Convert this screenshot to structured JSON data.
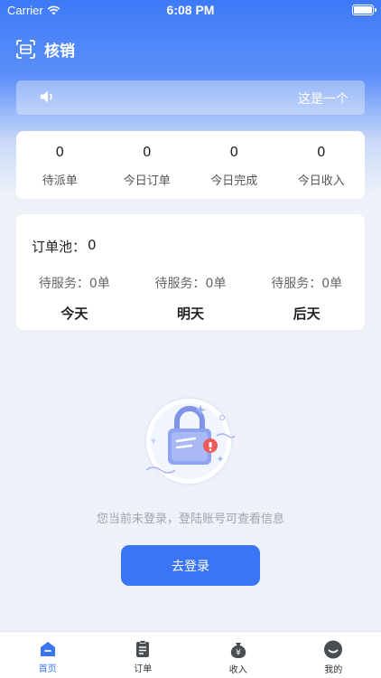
{
  "status_bar": {
    "carrier": "Carrier",
    "time": "6:08 PM"
  },
  "header": {
    "title": "核销",
    "icon": "scan-icon"
  },
  "notice": {
    "text": "这是一个",
    "icon": "speaker-icon"
  },
  "stats": [
    {
      "value": "0",
      "label": "待派单"
    },
    {
      "value": "0",
      "label": "今日订单"
    },
    {
      "value": "0",
      "label": "今日完成"
    },
    {
      "value": "0",
      "label": "今日收入"
    }
  ],
  "order_pool": {
    "label": "订单池：",
    "count": "0",
    "days": [
      {
        "status": "待服务：0单",
        "name": "今天"
      },
      {
        "status": "待服务：0单",
        "name": "明天"
      },
      {
        "status": "待服务：0单",
        "name": "后天"
      }
    ]
  },
  "empty_state": {
    "message": "您当前未登录，登陆账号可查看信息",
    "illustration": "lock-illustration"
  },
  "login_button": "去登录",
  "tabbar": [
    {
      "label": "首页",
      "icon": "home-icon",
      "active": true
    },
    {
      "label": "订单",
      "icon": "clipboard-icon",
      "active": false
    },
    {
      "label": "收入",
      "icon": "money-bag-icon",
      "active": false
    },
    {
      "label": "我的",
      "icon": "profile-icon",
      "active": false
    }
  ],
  "colors": {
    "primary": "#3a76f3",
    "background": "#eef2f8"
  }
}
